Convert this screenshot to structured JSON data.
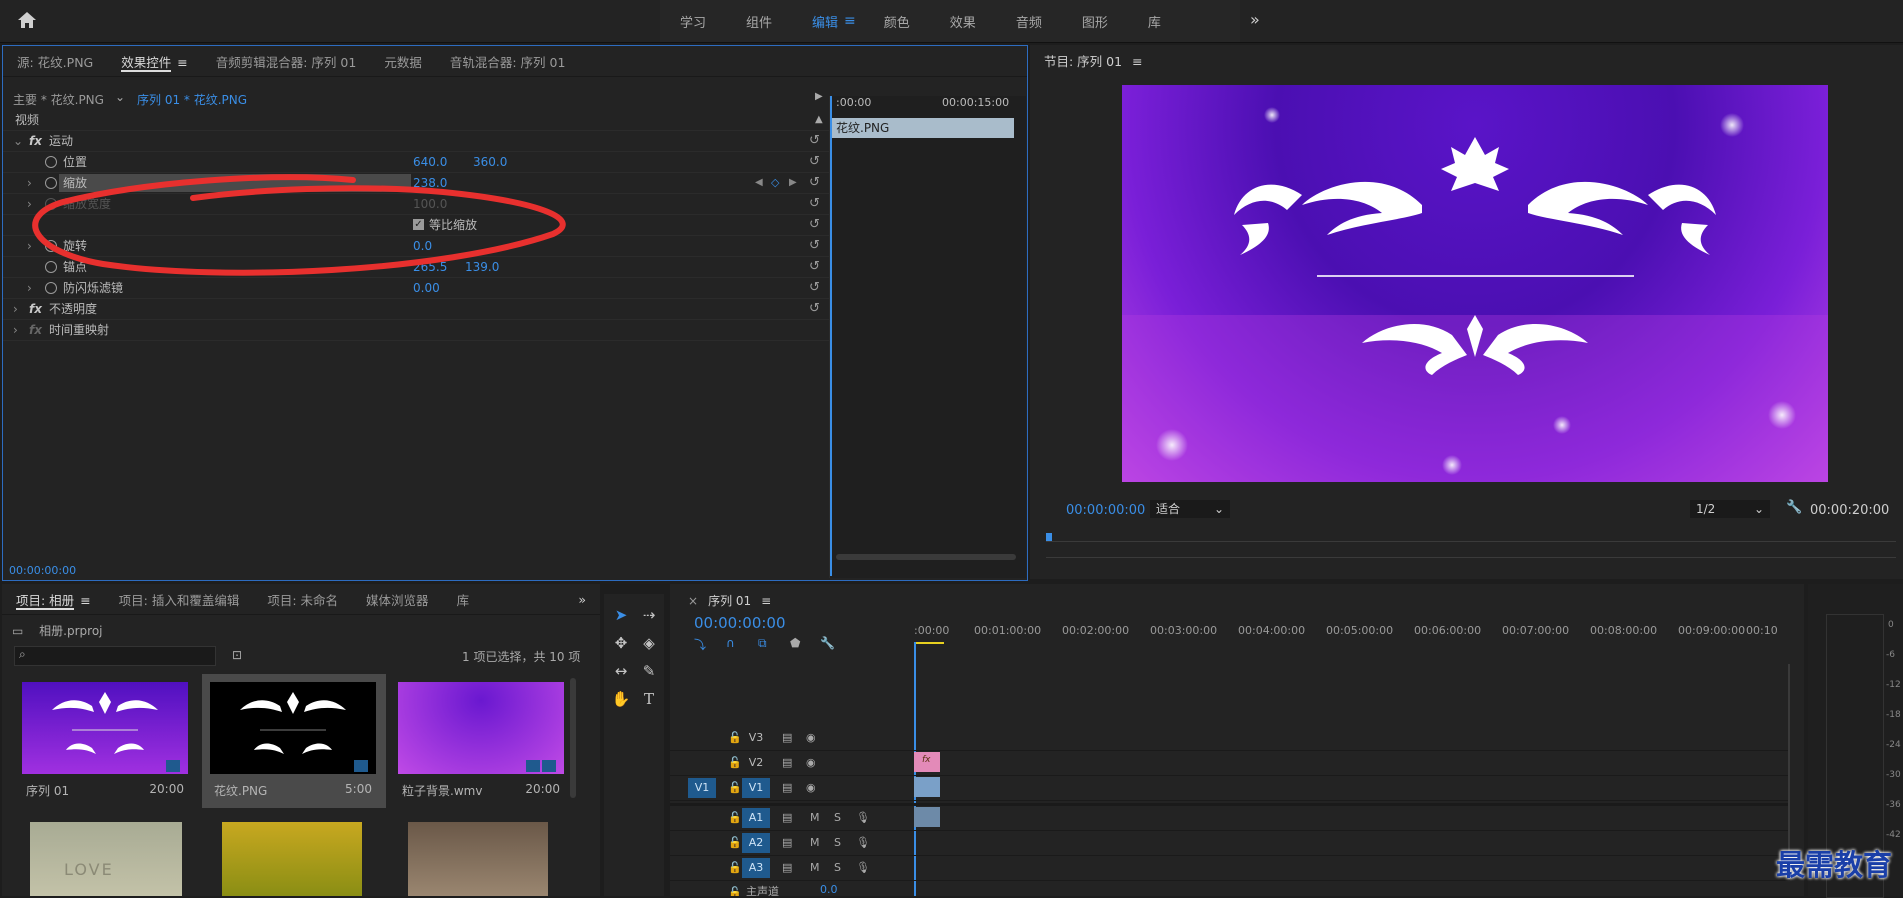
{
  "workspaces": {
    "tabs": [
      "学习",
      "组件",
      "编辑",
      "颜色",
      "效果",
      "音频",
      "图形",
      "库"
    ],
    "active": "编辑"
  },
  "effect_panel": {
    "tabs": [
      "源: 花纹.PNG",
      "效果控件",
      "音频剪辑混合器: 序列 01",
      "元数据",
      "音轨混合器: 序列 01"
    ],
    "master_label": "主要 * 花纹.PNG",
    "clip_label": "序列 01 * 花纹.PNG",
    "section_video": "视频",
    "effect_motion": "运动",
    "prop_position": "位置",
    "position_x": "640.0",
    "position_y": "360.0",
    "prop_scale": "缩放",
    "scale_value": "238.0",
    "prop_scale_width": "缩放宽度",
    "scale_width_value": "100.0",
    "uniform_scale": "等比缩放",
    "prop_rotation": "旋转",
    "rotation_value": "0.0",
    "prop_anchor": "锚点",
    "anchor_x": "265.5",
    "anchor_y": "139.0",
    "prop_flicker": "防闪烁滤镜",
    "flicker_value": "0.00",
    "effect_opacity": "不透明度",
    "effect_remap": "时间重映射",
    "tl_start": ":00:00",
    "tl_end": "00:00:15:00",
    "clip_name": "花纹.PNG",
    "timecode": "00:00:00:00"
  },
  "program": {
    "title": "节目: 序列 01",
    "timecode": "00:00:00:00",
    "fit": "适合",
    "resolution": "1/2",
    "duration": "00:00:20:00"
  },
  "project": {
    "tabs": [
      "项目: 相册",
      "项目: 插入和覆盖编辑",
      "项目: 未命名",
      "媒体浏览器",
      "库"
    ],
    "file": "相册.prproj",
    "selection": "1 项已选择，共 10 项",
    "items": [
      {
        "name": "序列 01",
        "duration": "20:00"
      },
      {
        "name": "花纹.PNG",
        "duration": "5:00"
      },
      {
        "name": "粒子背景.wmv",
        "duration": "20:00"
      }
    ],
    "love_text": "LOVE"
  },
  "timeline": {
    "title": "序列 01",
    "timecode": "00:00:00:00",
    "ruler": [
      ":00:00",
      "00:01:00:00",
      "00:02:00:00",
      "00:03:00:00",
      "00:04:00:00",
      "00:05:00:00",
      "00:06:00:00",
      "00:07:00:00",
      "00:08:00:00",
      "00:09:00:00",
      "00:10"
    ],
    "video_tracks": [
      "V3",
      "V2",
      "V1"
    ],
    "source_v": "V1",
    "audio_tracks": [
      "A1",
      "A2",
      "A3"
    ],
    "mute": "M",
    "solo": "S",
    "master": "主声道",
    "master_value": "0.0",
    "fx_badge": "fx"
  },
  "meters": [
    "0",
    "-6",
    "-12",
    "-18",
    "-24",
    "-30",
    "-36",
    "-42"
  ],
  "watermark": "最需教育",
  "colors": {
    "accent": "#3a8ee6",
    "annotation": "#e8302e"
  }
}
